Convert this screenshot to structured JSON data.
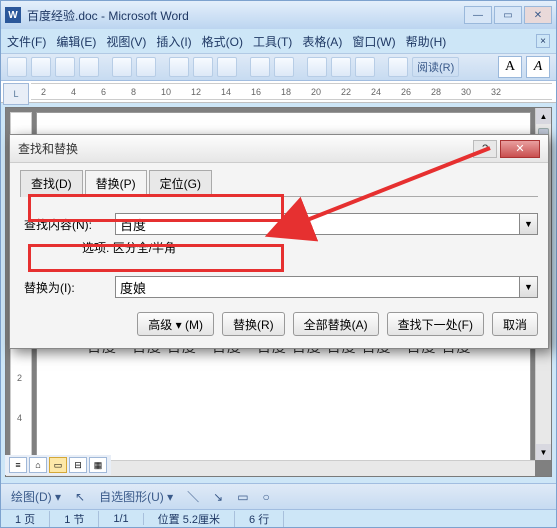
{
  "window": {
    "title": "百度经验.doc - Microsoft Word",
    "app_glyph": "W"
  },
  "menu": {
    "file": "文件(F)",
    "edit": "编辑(E)",
    "view": "视图(V)",
    "insert": "插入(I)",
    "format": "格式(O)",
    "tools": "工具(T)",
    "table": "表格(A)",
    "window": "窗口(W)",
    "help": "帮助(H)"
  },
  "toolbar": {
    "read_label": "阅读(R)",
    "font_a": "A"
  },
  "ruler": {
    "marks": [
      "2",
      "4",
      "6",
      "8",
      "10",
      "12",
      "14",
      "16",
      "18",
      "20",
      "22",
      "24",
      "26",
      "28",
      "30",
      "32"
    ]
  },
  "vruler": {
    "marks": [
      "",
      "2",
      "",
      "2",
      "4"
    ]
  },
  "document": {
    "line1": "百度　百度 百度　百度　百度 百度 百度 百度　百度 百度"
  },
  "dialog": {
    "title": "查找和替换",
    "tabs": {
      "find": "查找(D)",
      "replace": "替换(P)",
      "goto": "定位(G)"
    },
    "find_label": "查找内容(N):",
    "find_value": "百度",
    "options_label": "选项:",
    "options_value": "区分全/半角",
    "replace_label": "替换为(I):",
    "replace_value": "度娘",
    "buttons": {
      "advanced": "高级 ▾  (M)",
      "replace": "替换(R)",
      "replace_all": "全部替换(A)",
      "find_next": "查找下一处(F)",
      "cancel": "取消"
    }
  },
  "drawbar": {
    "draw": "绘图(D) ▾",
    "autoshape": "自选图形(U) ▾"
  },
  "status": {
    "page": "1 页",
    "section": "1 节",
    "pages": "1/1",
    "position": "位置 5.2厘米",
    "line": "6 行"
  }
}
